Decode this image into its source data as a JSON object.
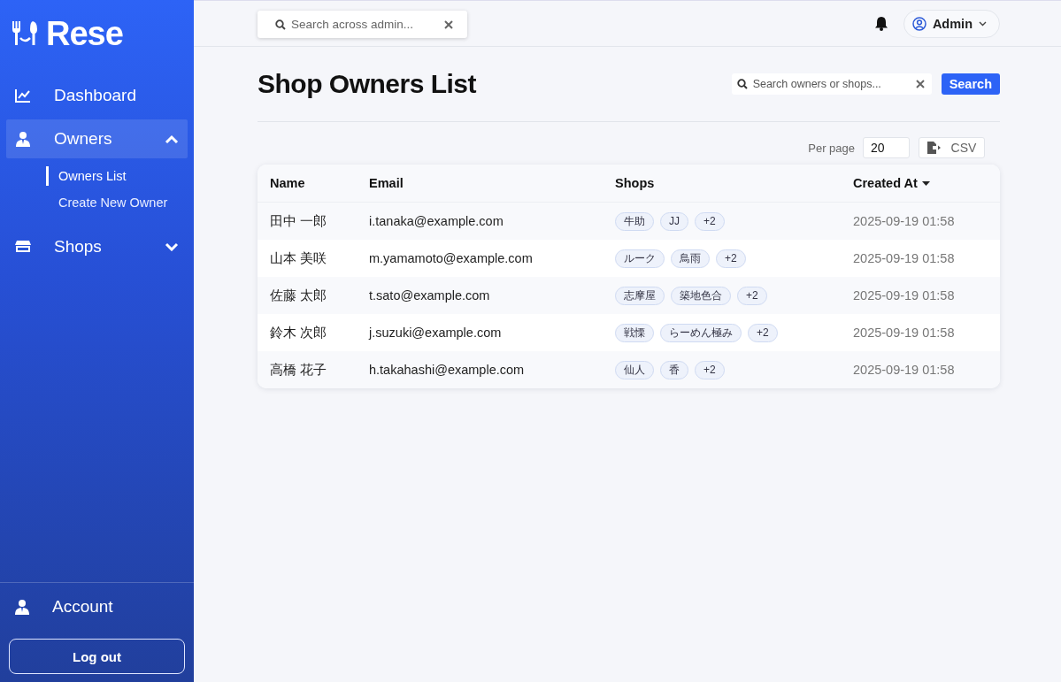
{
  "brand": {
    "name": "Rese"
  },
  "sidebar": {
    "items": [
      {
        "label": "Dashboard",
        "kind": "chart",
        "selected": false
      },
      {
        "label": "Owners",
        "kind": "person",
        "selected": true,
        "expanded": true,
        "children": [
          {
            "label": "Owners List",
            "selected": true
          },
          {
            "label": "Create New Owner",
            "selected": false
          }
        ]
      },
      {
        "label": "Shops",
        "kind": "store",
        "selected": false,
        "expanded": false
      }
    ],
    "account": {
      "label": "Account"
    },
    "logout": "Log out"
  },
  "topbar": {
    "search": {
      "placeholder": "Search across admin..."
    },
    "user": {
      "name": "Admin"
    }
  },
  "page": {
    "title": "Shop Owners List",
    "search": {
      "placeholder": "Search owners or shops..."
    },
    "search_button": "Search",
    "per_page": {
      "label": "Per page",
      "value": "20"
    },
    "export_button": "CSV"
  },
  "table": {
    "columns": [
      {
        "label": "Name",
        "sorted": false
      },
      {
        "label": "Email",
        "sorted": false
      },
      {
        "label": "Shops",
        "sorted": false
      },
      {
        "label": "Created At",
        "sorted": true
      }
    ],
    "rows": [
      {
        "name": "田中 一郎",
        "email": "i.tanaka@example.com",
        "shops": [
          "牛助",
          "JJ"
        ],
        "more": "+2",
        "created": "2025-09-19 01:58"
      },
      {
        "name": "山本 美咲",
        "email": "m.yamamoto@example.com",
        "shops": [
          "ルーク",
          "鳥雨"
        ],
        "more": "+2",
        "created": "2025-09-19 01:58"
      },
      {
        "name": "佐藤 太郎",
        "email": "t.sato@example.com",
        "shops": [
          "志摩屋",
          "築地色合"
        ],
        "more": "+2",
        "created": "2025-09-19 01:58"
      },
      {
        "name": "鈴木 次郎",
        "email": "j.suzuki@example.com",
        "shops": [
          "戦慄",
          "らーめん極み"
        ],
        "more": "+2",
        "created": "2025-09-19 01:58"
      },
      {
        "name": "高橋 花子",
        "email": "h.takahashi@example.com",
        "shops": [
          "仙人",
          "香"
        ],
        "more": "+2",
        "created": "2025-09-19 01:58"
      }
    ]
  }
}
